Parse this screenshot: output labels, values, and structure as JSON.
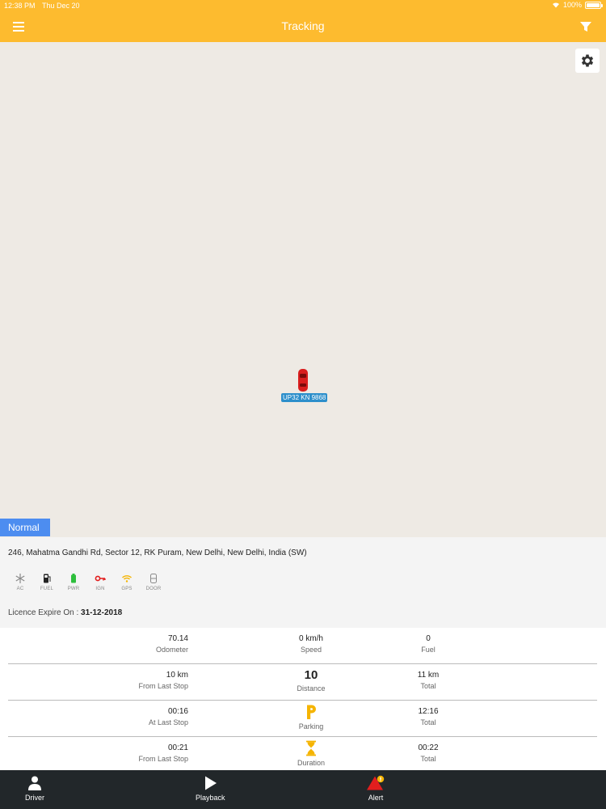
{
  "status_bar": {
    "time": "12:38 PM",
    "date": "Thu Dec 20",
    "battery": "100%"
  },
  "header": {
    "title": "Tracking"
  },
  "map": {
    "vehicle_plate": "UP32 KN 9868",
    "status_label": "Normal"
  },
  "info": {
    "address": "246, Mahatma Gandhi Rd, Sector 12, RK Puram, New Delhi, New Delhi,  India (SW)",
    "indicators": [
      {
        "label": "AC",
        "icon": "snowflake-icon",
        "color": "#8A8A8A"
      },
      {
        "label": "FUEL",
        "icon": "fuel-icon",
        "color": "#222222"
      },
      {
        "label": "PWR",
        "icon": "battery-icon",
        "color": "#2DBE3C"
      },
      {
        "label": "IGN",
        "icon": "key-icon",
        "color": "#E21E1E"
      },
      {
        "label": "GPS",
        "icon": "wifi-icon",
        "color": "#F5B400"
      },
      {
        "label": "DOOR",
        "icon": "door-icon",
        "color": "#8A8A8A"
      }
    ],
    "licence_label": "Licence Expire On :",
    "licence_date": "31-12-2018"
  },
  "stats": {
    "row1": {
      "odometer_value": "70.14",
      "odometer_label": "Odometer",
      "speed_value": "0 km/h",
      "speed_label": "Speed",
      "fuel_value": "0",
      "fuel_label": "Fuel"
    },
    "row2": {
      "left_value": "10 km",
      "left_label": "From Last Stop",
      "center_value": "10",
      "center_label": "Distance",
      "right_value": "11 km",
      "right_label": "Total"
    },
    "row3": {
      "left_value": "00:16",
      "left_label": "At Last Stop",
      "center_label": "Parking",
      "right_value": "12:16",
      "right_label": "Total"
    },
    "row4": {
      "left_value": "00:21",
      "left_label": "From Last Stop",
      "center_label": "Duration",
      "right_value": "00:22",
      "right_label": "Total"
    }
  },
  "nav": {
    "driver": "Driver",
    "playback": "Playback",
    "alert": "Alert"
  },
  "colors": {
    "header": "#FDBB2F",
    "status_chip": "#4D8DF0",
    "plate": "#2D8FCB",
    "nav": "#22272A"
  }
}
